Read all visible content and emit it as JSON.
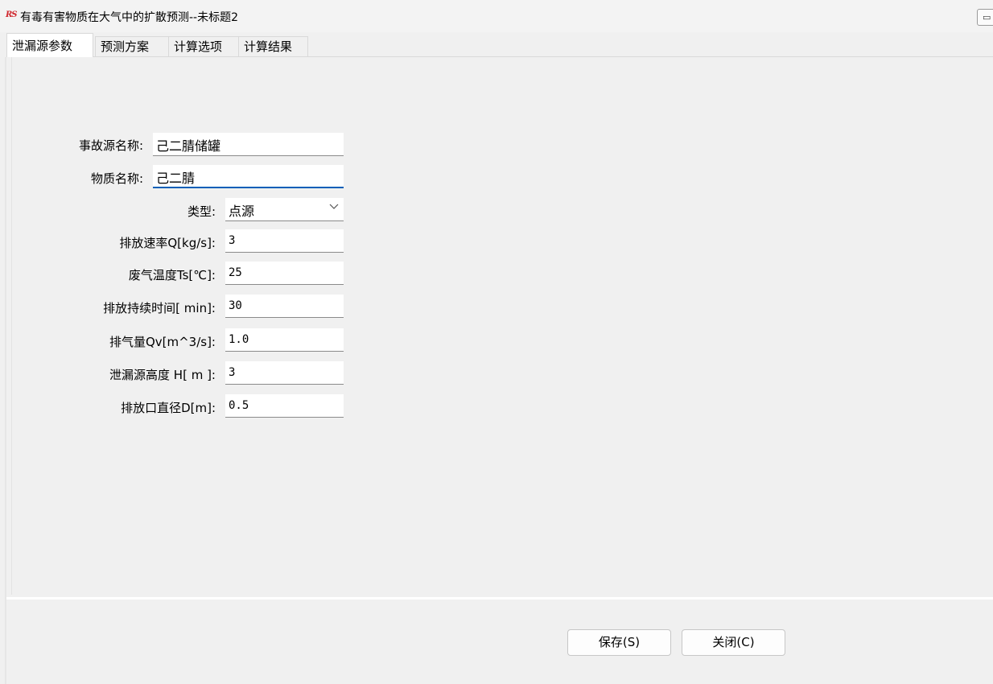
{
  "window": {
    "app_icon_text": "RS",
    "title": "有毒有害物质在大气中的扩散预测--未标题2",
    "control_glyph": "▭"
  },
  "tabs": [
    {
      "label": "泄漏源参数",
      "active": true
    },
    {
      "label": "预测方案",
      "active": false
    },
    {
      "label": "计算选项",
      "active": false
    },
    {
      "label": "计算结果",
      "active": false
    }
  ],
  "form": {
    "source_name": {
      "label": "事故源名称:",
      "value": "己二腈储罐"
    },
    "substance_name": {
      "label": "物质名称:",
      "value": "己二腈"
    },
    "type": {
      "label": "类型:",
      "value": "点源"
    },
    "emission_rate": {
      "label": "排放速率Q[kg/s]:",
      "value": "3"
    },
    "gas_temperature": {
      "label": "废气温度Ts[℃]:",
      "value": "25"
    },
    "duration": {
      "label": "排放持续时间[ min]:",
      "value": "30"
    },
    "gas_volume": {
      "label": "排气量Qv[m^3/s]:",
      "value": "1.0"
    },
    "source_height": {
      "label": "泄漏源高度 H[  m ]:",
      "value": "3"
    },
    "outlet_diameter": {
      "label": "排放口直径D[m]:",
      "value": "0.5"
    }
  },
  "buttons": {
    "save": "保存(S)",
    "close": "关闭(C)"
  },
  "icons": {
    "dropdown": "chevron-down-icon"
  }
}
